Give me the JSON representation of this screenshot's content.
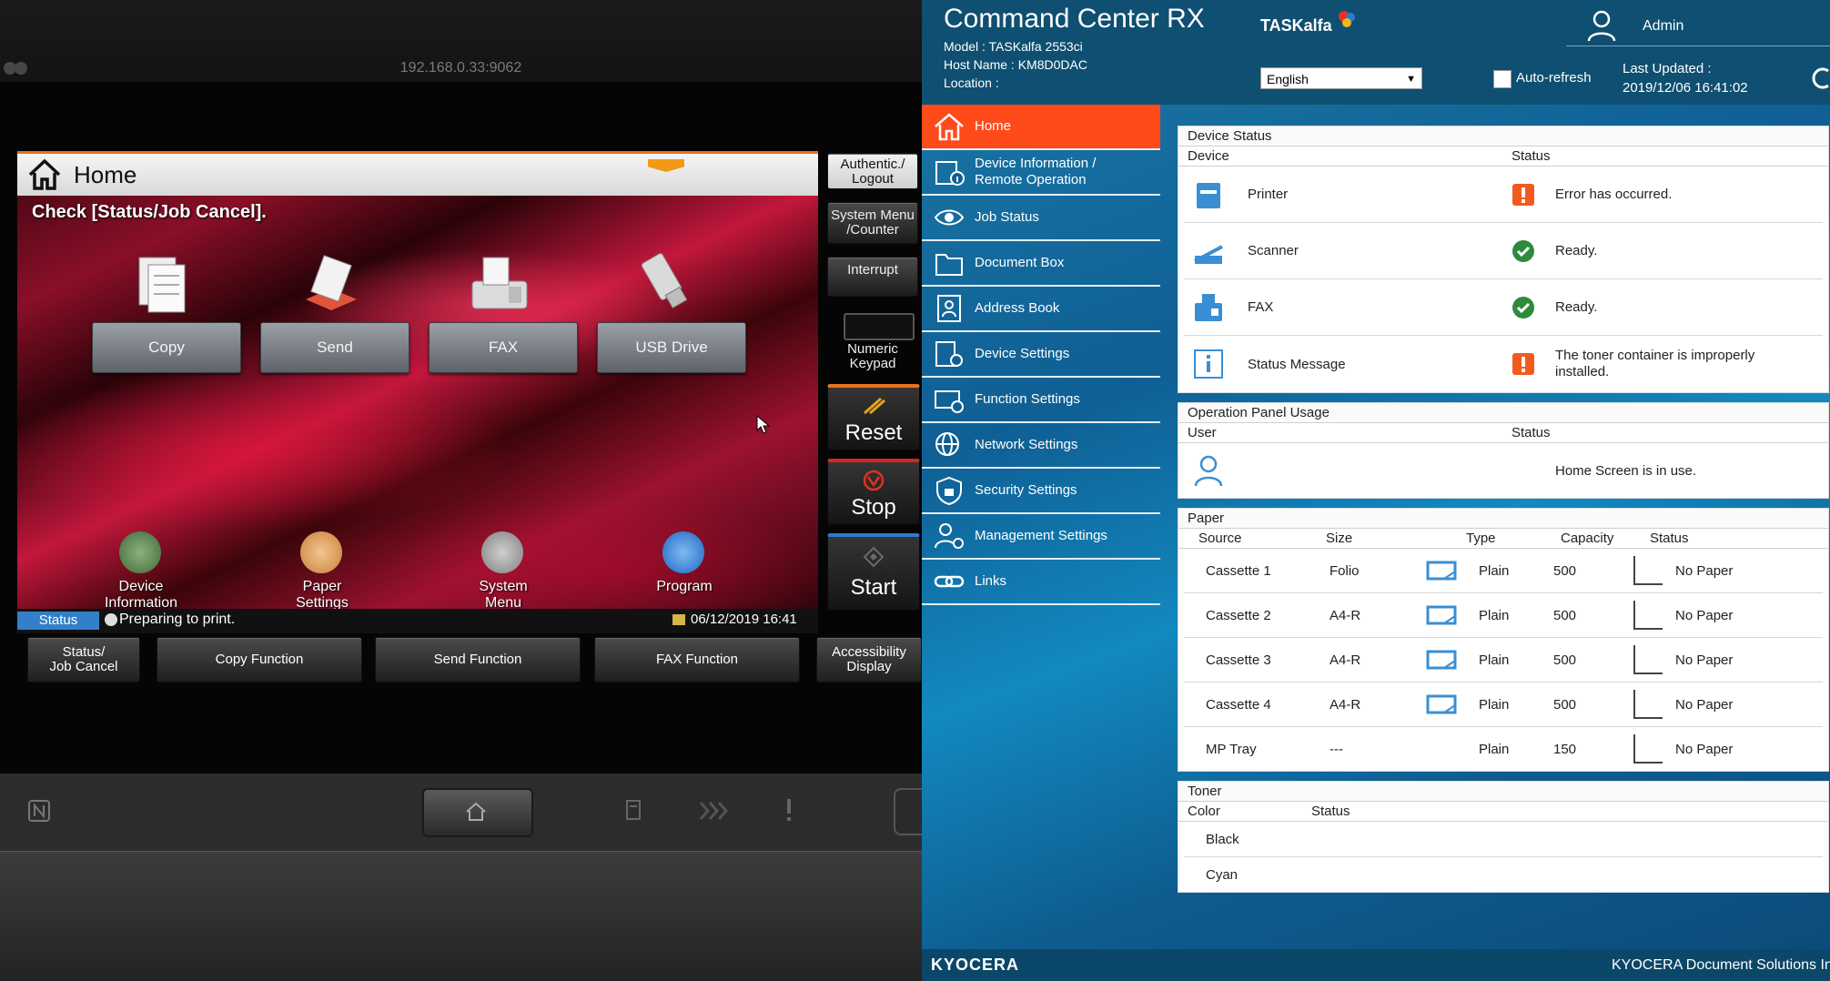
{
  "panel": {
    "url": "192.168.0.33:9062",
    "screen_title": "Home",
    "message": "Check [Status/Job Cancel].",
    "functions": [
      "Copy",
      "Send",
      "FAX",
      "USB Drive"
    ],
    "lower_icons": [
      {
        "label": "Device\nInformation"
      },
      {
        "label": "Paper\nSettings"
      },
      {
        "label": "System\nMenu"
      },
      {
        "label": "Program"
      }
    ],
    "status_tag": "Status",
    "status_text": "Preparing to print.",
    "status_date": "06/12/2019  16:41",
    "bottom_buttons": [
      "Status/\nJob Cancel",
      "Copy Function",
      "Send Function",
      "FAX Function",
      "Accessibility\nDisplay"
    ],
    "side_buttons": {
      "auth": "Authentic./\nLogout",
      "system": "System Menu\n/Counter",
      "interrupt": "Interrupt",
      "keypad": "Numeric\nKeypad",
      "reset": "Reset",
      "stop": "Stop",
      "start": "Start"
    },
    "colors": {
      "accent": "#e8721c",
      "status": "#3380c8"
    }
  },
  "cc": {
    "title": "Command Center RX",
    "model": "Model : TASKalfa 2553ci",
    "host": "Host Name : KM8D0DAC",
    "location": "Location :",
    "brand": "TASKalfa",
    "user": "Admin",
    "language": "English",
    "auto_refresh": "Auto-refresh",
    "last_updated_label": "Last Updated :",
    "last_updated_value": "2019/12/06 16:41:02",
    "nav": [
      {
        "label": "Home",
        "icon": "home-icon"
      },
      {
        "label": "Device Information /\nRemote Operation",
        "icon": "device-info-icon"
      },
      {
        "label": "Job Status",
        "icon": "eye-icon"
      },
      {
        "label": "Document Box",
        "icon": "folder-icon"
      },
      {
        "label": "Address Book",
        "icon": "address-book-icon"
      },
      {
        "label": "Device Settings",
        "icon": "device-settings-icon"
      },
      {
        "label": "Function Settings",
        "icon": "function-settings-icon"
      },
      {
        "label": "Network Settings",
        "icon": "network-icon"
      },
      {
        "label": "Security Settings",
        "icon": "shield-icon"
      },
      {
        "label": "Management Settings",
        "icon": "management-icon"
      },
      {
        "label": "Links",
        "icon": "link-icon"
      }
    ],
    "device_status": {
      "title": "Device Status",
      "col_device": "Device",
      "col_status": "Status",
      "rows": [
        {
          "device": "Printer",
          "status": "Error has occurred.",
          "kind": "error"
        },
        {
          "device": "Scanner",
          "status": "Ready.",
          "kind": "ok"
        },
        {
          "device": "FAX",
          "status": "Ready.",
          "kind": "ok"
        },
        {
          "device": "Status Message",
          "status": "The toner container is improperly installed.",
          "kind": "error"
        }
      ]
    },
    "panel_usage": {
      "title": "Operation Panel Usage",
      "col_user": "User",
      "col_status": "Status",
      "status": "Home Screen is in use."
    },
    "paper": {
      "title": "Paper",
      "cols": [
        "Source",
        "Size",
        "Type",
        "Capacity",
        "Status"
      ],
      "rows": [
        {
          "source": "Cassette 1",
          "size": "Folio",
          "type": "Plain",
          "capacity": "500",
          "status": "No Paper"
        },
        {
          "source": "Cassette 2",
          "size": "A4-R",
          "type": "Plain",
          "capacity": "500",
          "status": "No Paper"
        },
        {
          "source": "Cassette 3",
          "size": "A4-R",
          "type": "Plain",
          "capacity": "500",
          "status": "No Paper"
        },
        {
          "source": "Cassette 4",
          "size": "A4-R",
          "type": "Plain",
          "capacity": "500",
          "status": "No Paper"
        },
        {
          "source": "MP Tray",
          "size": "---",
          "type": "Plain",
          "capacity": "150",
          "status": "No Paper"
        }
      ]
    },
    "toner": {
      "title": "Toner",
      "col_color": "Color",
      "col_status": "Status",
      "rows": [
        "Black",
        "Cyan"
      ]
    },
    "footer_logo": "KYOCERA",
    "footer_copy": "KYOCERA Document Solutions Inc.",
    "colors": {
      "header": "#0f4f71",
      "active": "#ff4a1a",
      "error": "#f25a1d",
      "ok": "#2e8b3a"
    }
  }
}
